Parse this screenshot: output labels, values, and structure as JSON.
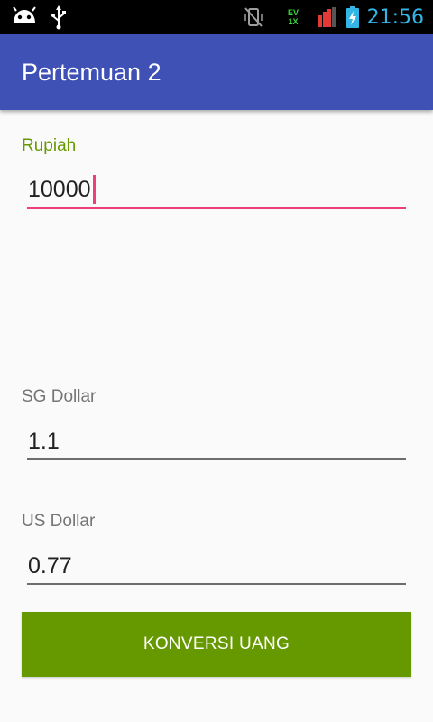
{
  "status_bar": {
    "time": "21:56",
    "time_color": "#33b5e5",
    "icons": [
      "android-icon",
      "usb-icon",
      "vibrate-off-icon",
      "signal-ev-icon",
      "signal-bars-icon",
      "battery-charging-icon"
    ],
    "ev_text": "EV",
    "ix_text": "1X"
  },
  "app_bar": {
    "title": "Pertemuan 2",
    "color": "#3f51b5"
  },
  "form": {
    "rupiah": {
      "label": "Rupiah",
      "value": "10000",
      "focused": true
    },
    "sg_dollar": {
      "label": "SG Dollar",
      "value": "1.1"
    },
    "us_dollar": {
      "label": "US Dollar",
      "value": "0.77"
    },
    "convert_button": {
      "label": "KONVERSI UANG",
      "color": "#669900"
    }
  },
  "colors": {
    "focused_label": "#669900",
    "focused_underline": "#ec407a"
  }
}
